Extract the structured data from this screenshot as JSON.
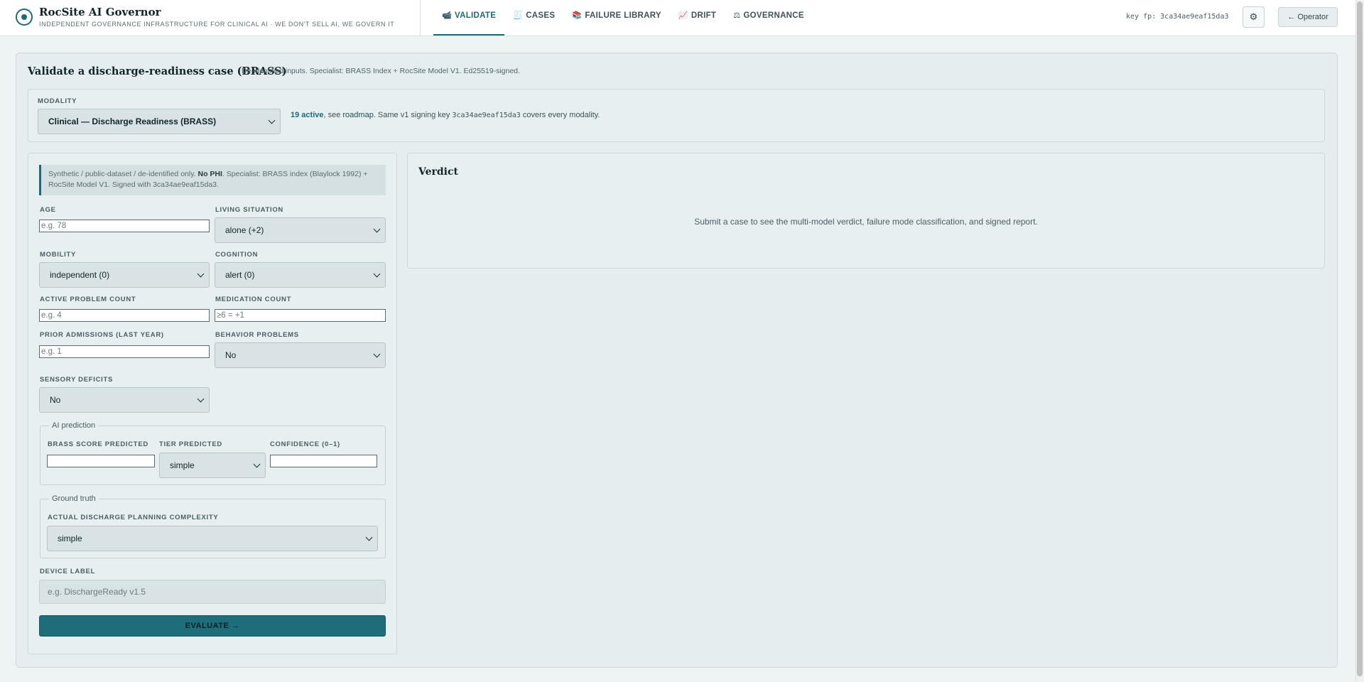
{
  "header": {
    "brand_title": "RocSite AI Governor",
    "brand_subtitle": "INDEPENDENT GOVERNANCE INFRASTRUCTURE FOR CLINICAL AI · WE DON'T SELL AI, WE GOVERN IT",
    "tabs": [
      {
        "icon": "📹",
        "label": "VALIDATE",
        "active": true
      },
      {
        "icon": "🧾",
        "label": "CASES",
        "active": false
      },
      {
        "icon": "📚",
        "label": "FAILURE LIBRARY",
        "active": false
      },
      {
        "icon": "📈",
        "label": "DRIFT",
        "active": false
      },
      {
        "icon": "⚖",
        "label": "GOVERNANCE",
        "active": false
      }
    ],
    "key_fp": "key fp: 3ca34ae9eaf15da3",
    "settings_icon": "⚙",
    "operator_label": "← Operator"
  },
  "page": {
    "title": "Validate a discharge-readiness case (BRASS)",
    "subtitle": "De-identified inputs. Specialist: BRASS Index + RocSite Model V1. Ed25519-signed."
  },
  "modality": {
    "label": "MODALITY",
    "selected": "Clinical — Discharge Readiness (BRASS)",
    "active_count": "19 active",
    "note_see": ", see ",
    "roadmap_link": "roadmap",
    "note_mid": ". Same v1 signing key ",
    "key": "3ca34ae9eaf15da3",
    "note_end": " covers every modality."
  },
  "form": {
    "notice_plain1": "Synthetic / public-dataset / de-identified only. ",
    "notice_bold": "No PHI",
    "notice_plain2": ". Specialist: BRASS index (Blaylock 1992) + RocSite Model V1. Signed with 3ca34ae9eaf15da3.",
    "age": {
      "label": "AGE",
      "placeholder": "e.g. 78"
    },
    "living": {
      "label": "LIVING SITUATION",
      "value": "alone (+2)"
    },
    "mobility": {
      "label": "MOBILITY",
      "value": "independent (0)"
    },
    "cognition": {
      "label": "COGNITION",
      "value": "alert (0)"
    },
    "problems": {
      "label": "ACTIVE PROBLEM COUNT",
      "placeholder": "e.g. 4"
    },
    "medications": {
      "label": "MEDICATION COUNT",
      "placeholder": "≥6 = +1"
    },
    "admissions": {
      "label": "PRIOR ADMISSIONS (LAST YEAR)",
      "placeholder": "e.g. 1"
    },
    "behavior": {
      "label": "BEHAVIOR PROBLEMS",
      "value": "No"
    },
    "sensory": {
      "label": "SENSORY DEFICITS",
      "value": "No"
    },
    "ai_prediction": {
      "legend": "AI prediction",
      "brass_label": "BRASS SCORE PREDICTED",
      "brass_value": "",
      "tier_label": "TIER PREDICTED",
      "tier_value": "simple",
      "confidence_label": "CONFIDENCE (0–1)",
      "confidence_value": ""
    },
    "ground_truth": {
      "legend": "Ground truth",
      "complexity_label": "ACTUAL DISCHARGE PLANNING COMPLEXITY",
      "complexity_value": "simple"
    },
    "device": {
      "label": "DEVICE LABEL",
      "placeholder": "e.g. DischargeReady v1.5"
    },
    "evaluate_label": "EVALUATE →"
  },
  "verdict": {
    "title": "Verdict",
    "empty_message": "Submit a case to see the multi-model verdict, failure mode classification, and signed report."
  },
  "colors": {
    "accent": "#1e6b76",
    "button": "#1d6d7a",
    "background": "#eef3f3",
    "panel": "#e7eff0"
  }
}
